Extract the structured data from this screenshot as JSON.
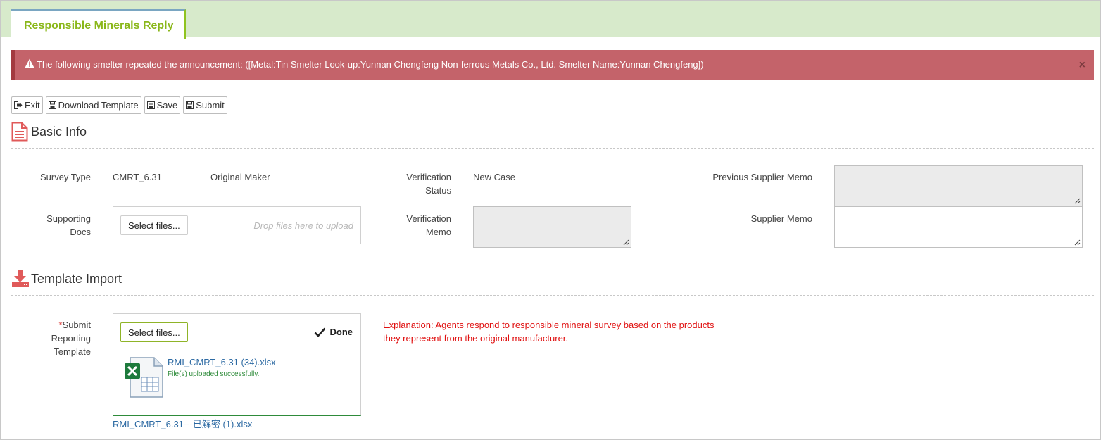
{
  "tab": {
    "label": "Responsible Minerals Reply"
  },
  "alert": {
    "message": "The following smelter repeated the announcement: ([Metal:Tin Smelter Look-up:Yunnan Chengfeng Non-ferrous Metals Co., Ltd. Smelter Name:Yunnan Chengfeng])",
    "close": "×",
    "icon": "warning-icon"
  },
  "toolbar": {
    "exit": "Exit",
    "download_template": "Download Template",
    "save": "Save",
    "submit": "Submit"
  },
  "basic_info": {
    "title": "Basic Info",
    "survey_type_label": "Survey Type",
    "survey_type_value": "CMRT_6.31",
    "original_maker": "Original Maker",
    "verification_status_label_1": "Verification",
    "verification_status_label_2": "Status",
    "verification_status_value": "New Case",
    "previous_supplier_memo_label": "Previous Supplier Memo",
    "supporting_docs_label_1": "Supporting",
    "supporting_docs_label_2": "Docs",
    "select_files": "Select files...",
    "drop_hint": "Drop files here to upload",
    "verification_memo_label_1": "Verification",
    "verification_memo_label_2": "Memo",
    "supplier_memo_label": "Supplier Memo"
  },
  "template_import": {
    "title": "Template Import",
    "required_mark": "*",
    "label_1": "Submit",
    "label_2": "Reporting",
    "label_3": "Template",
    "select_files": "Select files...",
    "done": "Done",
    "uploaded_file": "RMI_CMRT_6.31 (34).xlsx",
    "upload_status": "File(s) uploaded successfully.",
    "existing_file": "RMI_CMRT_6.31---已解密 (1).xlsx",
    "explanation_line_1": "Explanation: Agents respond to responsible mineral survey based on the products",
    "explanation_line_2": "they represent from the original manufacturer."
  },
  "colors": {
    "tab_strip": "#d7eacb",
    "tab_text": "#8ab71a",
    "alert_bg": "#c4636a",
    "section_icon": "#e05a5a",
    "explanation": "#e01010",
    "link": "#2d6aa3"
  }
}
